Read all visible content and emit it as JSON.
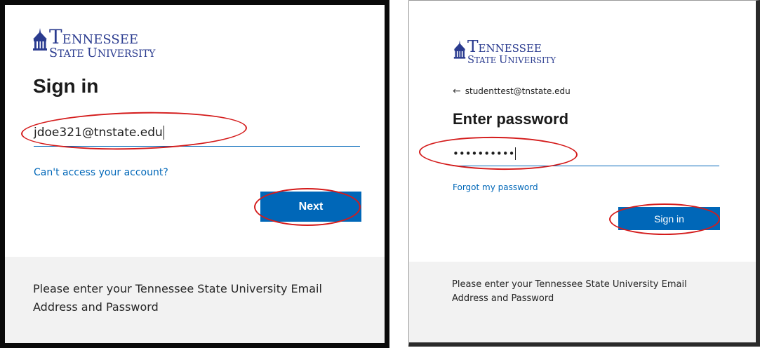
{
  "left_panel": {
    "logo": {
      "line1_cap": "T",
      "line1_rest": "ENNESSEE",
      "line2_cap1": "S",
      "line2_rest1": "TATE ",
      "line2_cap2": "U",
      "line2_rest2": "NIVERSITY",
      "icon": "university-building-icon"
    },
    "heading": "Sign in",
    "email_value": "jdoe321@tnstate.edu",
    "access_link": "Can't access your account?",
    "next_button": "Next",
    "footer_text": "Please enter your Tennessee State University Email Address and Password"
  },
  "right_panel": {
    "logo": {
      "line1_cap": "T",
      "line1_rest": "ENNESSEE",
      "line2_cap1": "S",
      "line2_rest1": "TATE ",
      "line2_cap2": "U",
      "line2_rest2": "NIVERSITY",
      "icon": "university-building-icon"
    },
    "back_arrow": "←",
    "account_email": "studenttest@tnstate.edu",
    "heading": "Enter password",
    "password_masked": "••••••••••",
    "forgot_link": "Forgot my password",
    "signin_button": "Sign in",
    "footer_text": "Please enter your Tennessee State University Email Address and Password"
  },
  "colors": {
    "accent_blue": "#0067b8",
    "logo_navy": "#2a3b8f",
    "annotation_red": "#d41b1b",
    "footer_gray": "#f2f2f2"
  }
}
